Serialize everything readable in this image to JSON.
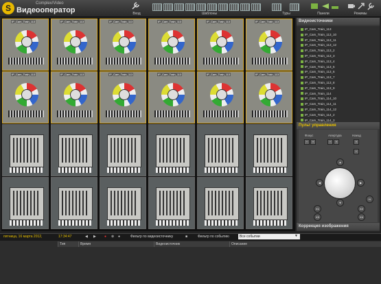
{
  "app": {
    "brand_small": "Complex/Video",
    "brand_big": "Видеооператор",
    "logo_letter": "S"
  },
  "toolbar": {
    "entry_label": "Вход",
    "templates_label": "Шаблоны",
    "tours_label": "Туры",
    "panels_label": "Панели",
    "modes_label": "Режимы"
  },
  "grid": {
    "row_labels": [
      "IP_Cam_Train_113",
      "IP_Cam_Train_115"
    ],
    "cams": [
      {
        "label": "IP_Cam_Train_113",
        "view": "chart",
        "active": true
      },
      {
        "label": "IP_Cam_Train_113",
        "view": "chart",
        "active": true
      },
      {
        "label": "IP_Cam_Train_113",
        "view": "chart",
        "active": true
      },
      {
        "label": "IP_Cam_Train_113",
        "view": "chart",
        "active": true
      },
      {
        "label": "IP_Cam_Train_113",
        "view": "chart",
        "active": true
      },
      {
        "label": "IP_Cam_Train_113",
        "view": "chart",
        "active": true
      },
      {
        "label": "IP_Cam_Train_113",
        "view": "chart",
        "active": true
      },
      {
        "label": "IP_Cam_Train_113",
        "view": "chart",
        "active": true
      },
      {
        "label": "IP_Cam_Train_113",
        "view": "chart",
        "active": true
      },
      {
        "label": "IP_Cam_Train_113",
        "view": "chart",
        "active": true
      },
      {
        "label": "IP_Cam_Train_113",
        "view": "chart",
        "active": true
      },
      {
        "label": "IP_Cam_Train_113",
        "view": "chart",
        "active": true
      },
      {
        "label": "",
        "view": "board",
        "active": false
      },
      {
        "label": "",
        "view": "board",
        "active": false
      },
      {
        "label": "",
        "view": "board",
        "active": false
      },
      {
        "label": "",
        "view": "board",
        "active": false
      },
      {
        "label": "",
        "view": "board",
        "active": false
      },
      {
        "label": "",
        "view": "board",
        "active": false
      },
      {
        "label": "",
        "view": "board",
        "active": false
      },
      {
        "label": "",
        "view": "board",
        "active": false
      },
      {
        "label": "",
        "view": "board",
        "active": false
      },
      {
        "label": "",
        "view": "board",
        "active": false
      },
      {
        "label": "",
        "view": "board",
        "active": false
      },
      {
        "label": "",
        "view": "board",
        "active": false
      }
    ]
  },
  "sources": {
    "title": "Видеоисточники",
    "items": [
      "IP_Cam_Train_113",
      "IP_Cam_Train_113_10",
      "IP_Cam_Train_113_11",
      "IP_Cam_Train_113_12",
      "IP_Cam_Train_113_2",
      "IP_Cam_Train_113_3",
      "IP_Cam_Train_113_4",
      "IP_Cam_Train_113_5",
      "IP_Cam_Train_113_6",
      "IP_Cam_Train_113_7",
      "IP_Cam_Train_113_8",
      "IP_Cam_Train_113_9",
      "IP_Cam_Train_114",
      "IP_Cam_Train_114_10",
      "IP_Cam_Train_114_11",
      "IP_Cam_Train_114_12",
      "IP_Cam_Train_114_2",
      "IP_Cam_Train_114_3"
    ]
  },
  "ptz": {
    "title": "Пульт управления",
    "focus": "Фокус",
    "aperture": "Апертура",
    "zoom": "Наезд",
    "home": "H",
    "buttons": [
      "X1",
      "X2",
      "X3",
      "X4"
    ]
  },
  "correction": {
    "title": "Коррекция изображения"
  },
  "status": {
    "date": "пятница, 16 марта 2012,",
    "time": "17:34:47",
    "filter_video": "Фильтр по видеоисточнику",
    "filter_event": "Фильтр по событию",
    "event_value": "Все событии"
  },
  "events": {
    "columns": [
      "Тип",
      "Время",
      "Видеоисточник",
      "Описание"
    ]
  },
  "colors": {
    "accent": "#d8a92a",
    "status_date": "#e8c000"
  }
}
